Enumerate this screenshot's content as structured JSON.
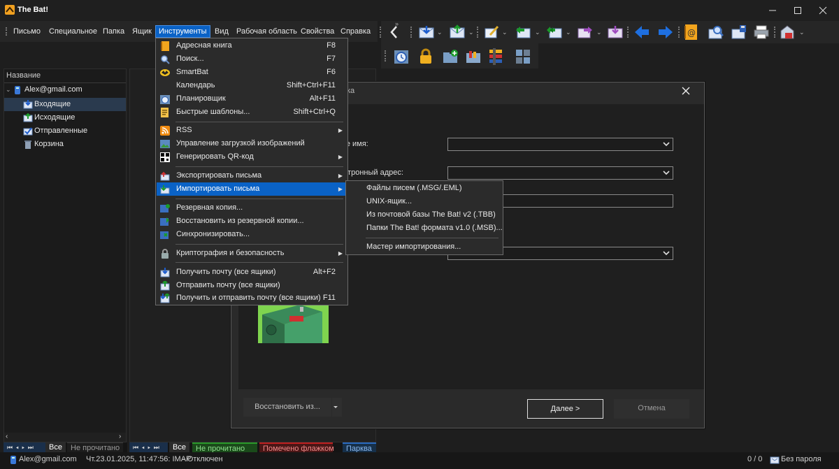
{
  "window": {
    "title": "The Bat!"
  },
  "menubar": {
    "items": [
      "Письмо",
      "Специальное",
      "Папка",
      "Ящик",
      "Инструменты",
      "Вид",
      "Рабочая область",
      "Свойства",
      "Справка"
    ],
    "active": "Инструменты"
  },
  "folders": {
    "header": "Название",
    "account": "Alex@gmail.com",
    "items": [
      "Входящие",
      "Исходящие",
      "Отправленные",
      "Корзина"
    ]
  },
  "tools_menu": {
    "items": [
      {
        "label": "Адресная книга",
        "shortcut": "F8"
      },
      {
        "label": "Поиск...",
        "shortcut": "F7"
      },
      {
        "label": "SmartBat",
        "shortcut": "F6"
      },
      {
        "label": "Календарь",
        "shortcut": "Shift+Ctrl+F11"
      },
      {
        "label": "Планировщик",
        "shortcut": "Alt+F11"
      },
      {
        "label": "Быстрые шаблоны...",
        "shortcut": "Shift+Ctrl+Q"
      },
      {
        "label": "RSS",
        "shortcut": ""
      },
      {
        "label": "Управление загрузкой изображений",
        "shortcut": ""
      },
      {
        "label": "Генерировать QR-код",
        "shortcut": ""
      },
      {
        "label": "Экспортировать письма",
        "shortcut": ""
      },
      {
        "label": "Импортировать письма",
        "shortcut": ""
      },
      {
        "label": "Резервная копия...",
        "shortcut": ""
      },
      {
        "label": "Восстановить из резервной копии...",
        "shortcut": ""
      },
      {
        "label": "Синхронизировать...",
        "shortcut": ""
      },
      {
        "label": "Криптография и безопасность",
        "shortcut": ""
      },
      {
        "label": "Получить почту (все ящики)",
        "shortcut": "Alt+F2"
      },
      {
        "label": "Отправить почту (все ящики)",
        "shortcut": ""
      },
      {
        "label": "Получить и отправить почту (все ящики)",
        "shortcut": "F11"
      }
    ]
  },
  "import_submenu": {
    "items": [
      "Файлы писем (.MSG/.EML)",
      "UNIX-ящик...",
      "Из почтовой базы The Bat! v2 (.TBB)",
      "Папки The Bat! формата v1.0 (.MSB)...",
      "Мастер импортирования..."
    ]
  },
  "dialog": {
    "title_fragment": "ка",
    "label_name": "ше имя:",
    "label_email": "ектронный адрес:",
    "restore_button": "Восстановить из...",
    "next_button": "Далее  >",
    "cancel_button": "Отмена"
  },
  "tabs_left": {
    "all": "Все",
    "unread": "Не прочитано"
  },
  "tabs_main": {
    "all": "Все",
    "unread": "Не прочитано",
    "flagged": "Помечено флажком",
    "parked": "Парква"
  },
  "status": {
    "account": "Alex@gmail.com",
    "datetime": "Чт.23.01.2025, 11:47:56: IMAP",
    "connection": "- Отключен",
    "counter": "0 / 0",
    "password": "Без пароля"
  },
  "colors": {
    "accent": "#0a62c6",
    "background": "#1e1e1e"
  }
}
